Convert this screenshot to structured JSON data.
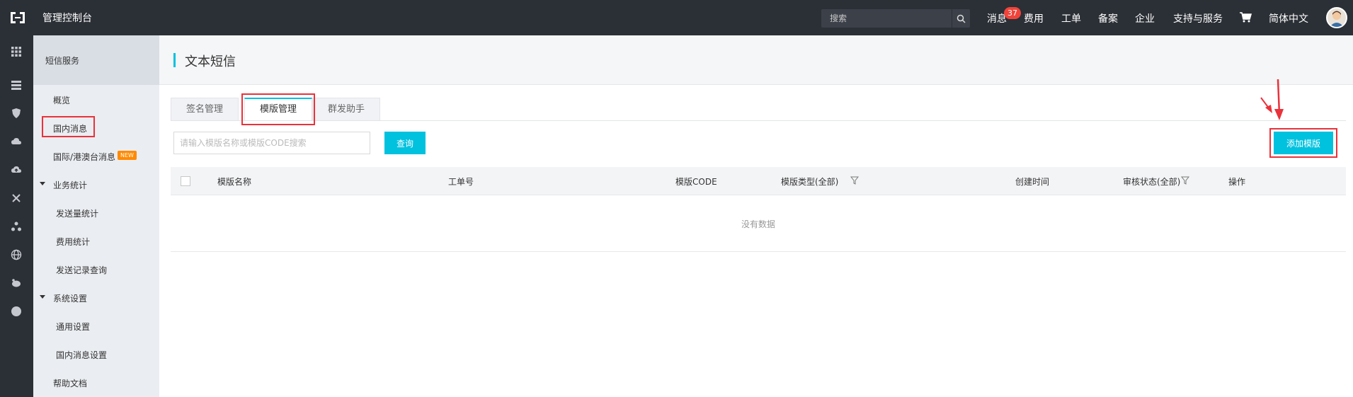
{
  "topbar": {
    "app_title": "管理控制台",
    "search_placeholder": "搜索",
    "nav": {
      "messages": "消息",
      "messages_count": "37",
      "billing": "费用",
      "tickets": "工单",
      "filing": "备案",
      "enterprise": "企业",
      "support": "支持与服务",
      "language": "简体中文"
    }
  },
  "sidebar": {
    "header": "短信服务",
    "items": [
      {
        "label": "概览"
      },
      {
        "label": "国内消息"
      },
      {
        "label": "国际/港澳台消息",
        "badge": "NEW"
      },
      {
        "label": "业务统计"
      },
      {
        "label": "发送量统计"
      },
      {
        "label": "费用统计"
      },
      {
        "label": "发送记录查询"
      },
      {
        "label": "系统设置"
      },
      {
        "label": "通用设置"
      },
      {
        "label": "国内消息设置"
      },
      {
        "label": "帮助文档"
      }
    ]
  },
  "main": {
    "title": "文本短信",
    "tabs": [
      {
        "label": "签名管理"
      },
      {
        "label": "模版管理"
      },
      {
        "label": "群发助手"
      }
    ],
    "filter": {
      "placeholder": "请输入模版名称或模版CODE搜索",
      "query_label": "查询",
      "add_label": "添加模版"
    },
    "table": {
      "columns": [
        "模版名称",
        "工单号",
        "模版CODE",
        "模版类型(全部)",
        "创建时间",
        "审核状态(全部)",
        "操作"
      ],
      "empty": "没有数据"
    }
  },
  "colors": {
    "accent": "#00c1de",
    "highlight": "#e9323b",
    "topbar": "#2b2f36"
  }
}
